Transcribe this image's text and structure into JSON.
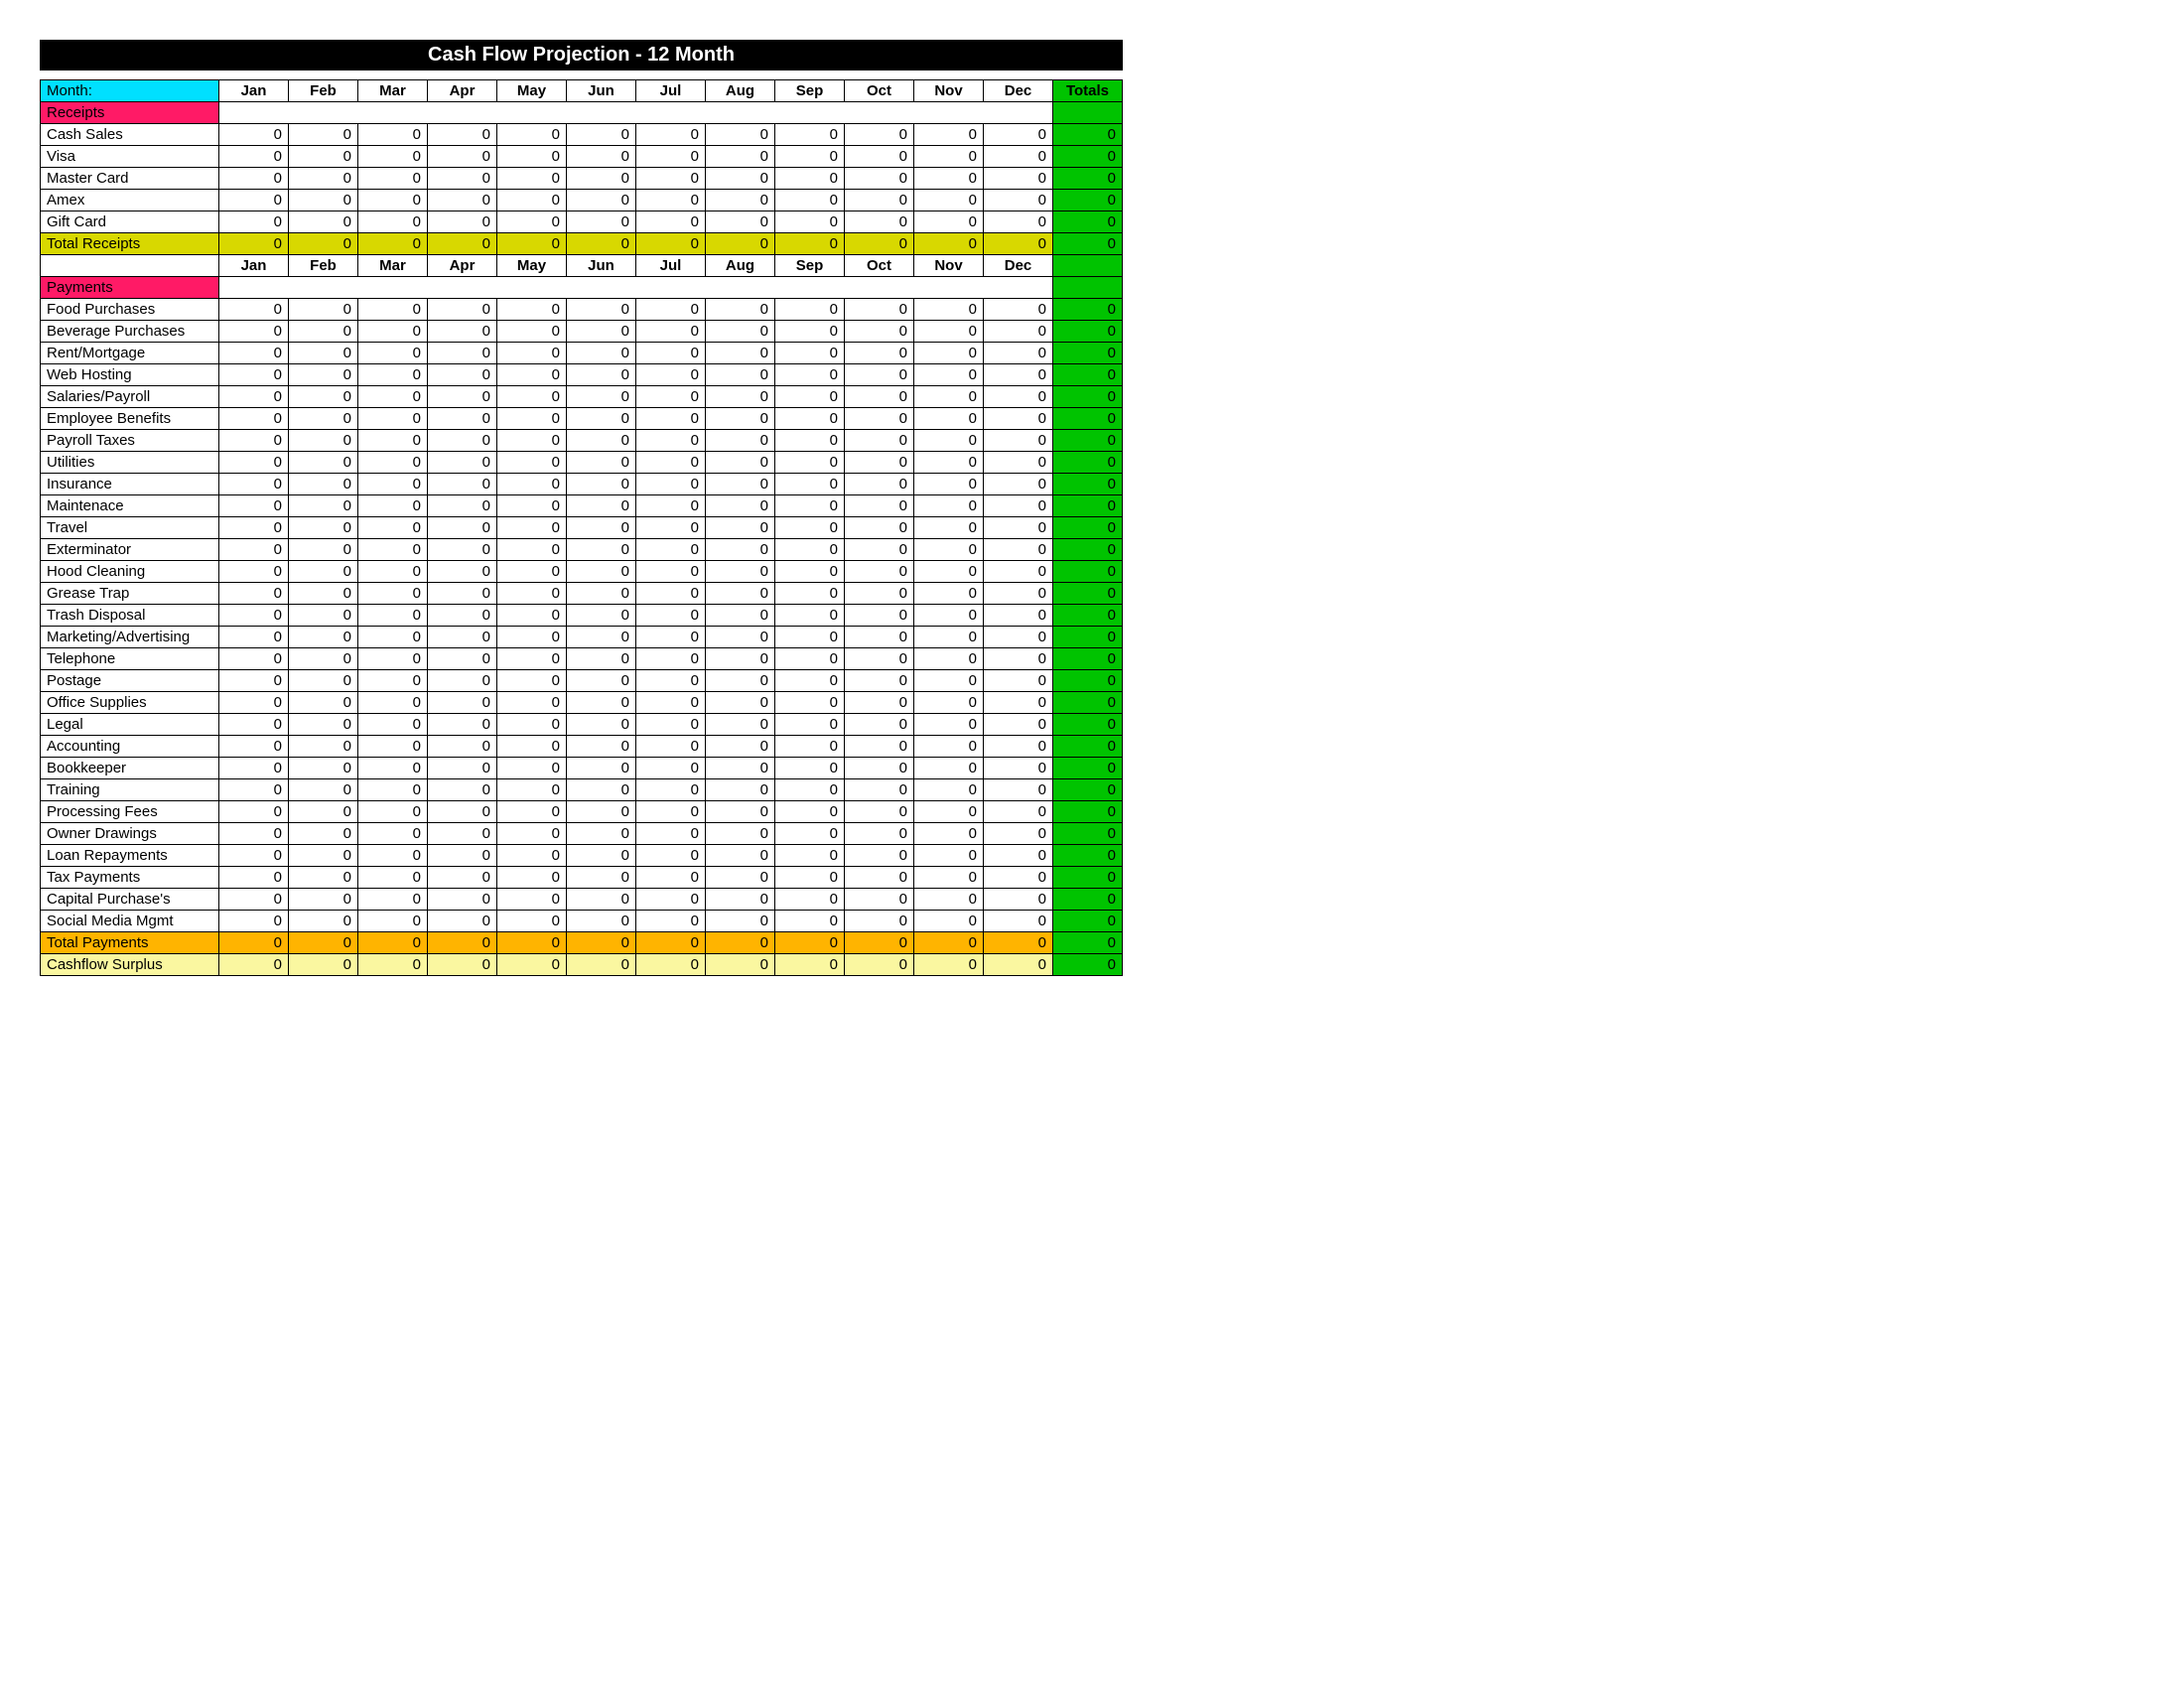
{
  "title": "Cash Flow Projection   -    12 Month",
  "month_label": "Month:",
  "months": [
    "Jan",
    "Feb",
    "Mar",
    "Apr",
    "May",
    "Jun",
    "Jul",
    "Aug",
    "Sep",
    "Oct",
    "Nov",
    "Dec"
  ],
  "totals_label": "Totals",
  "sections": {
    "receipts": {
      "heading": "Receipts",
      "rows": [
        {
          "label": "Cash Sales",
          "values": [
            0,
            0,
            0,
            0,
            0,
            0,
            0,
            0,
            0,
            0,
            0,
            0
          ],
          "total": 0
        },
        {
          "label": "Visa",
          "values": [
            0,
            0,
            0,
            0,
            0,
            0,
            0,
            0,
            0,
            0,
            0,
            0
          ],
          "total": 0
        },
        {
          "label": "Master Card",
          "values": [
            0,
            0,
            0,
            0,
            0,
            0,
            0,
            0,
            0,
            0,
            0,
            0
          ],
          "total": 0
        },
        {
          "label": "Amex",
          "values": [
            0,
            0,
            0,
            0,
            0,
            0,
            0,
            0,
            0,
            0,
            0,
            0
          ],
          "total": 0
        },
        {
          "label": "Gift Card",
          "values": [
            0,
            0,
            0,
            0,
            0,
            0,
            0,
            0,
            0,
            0,
            0,
            0
          ],
          "total": 0
        }
      ],
      "total_row": {
        "label": "Total Receipts",
        "values": [
          0,
          0,
          0,
          0,
          0,
          0,
          0,
          0,
          0,
          0,
          0,
          0
        ],
        "total": 0
      }
    },
    "payments": {
      "heading": "Payments",
      "rows": [
        {
          "label": "Food Purchases",
          "values": [
            0,
            0,
            0,
            0,
            0,
            0,
            0,
            0,
            0,
            0,
            0,
            0
          ],
          "total": 0
        },
        {
          "label": "Beverage Purchases",
          "values": [
            0,
            0,
            0,
            0,
            0,
            0,
            0,
            0,
            0,
            0,
            0,
            0
          ],
          "total": 0
        },
        {
          "label": "Rent/Mortgage",
          "values": [
            0,
            0,
            0,
            0,
            0,
            0,
            0,
            0,
            0,
            0,
            0,
            0
          ],
          "total": 0
        },
        {
          "label": "Web Hosting",
          "values": [
            0,
            0,
            0,
            0,
            0,
            0,
            0,
            0,
            0,
            0,
            0,
            0
          ],
          "total": 0
        },
        {
          "label": "Salaries/Payroll",
          "values": [
            0,
            0,
            0,
            0,
            0,
            0,
            0,
            0,
            0,
            0,
            0,
            0
          ],
          "total": 0
        },
        {
          "label": "Employee Benefits",
          "values": [
            0,
            0,
            0,
            0,
            0,
            0,
            0,
            0,
            0,
            0,
            0,
            0
          ],
          "total": 0
        },
        {
          "label": "Payroll Taxes",
          "values": [
            0,
            0,
            0,
            0,
            0,
            0,
            0,
            0,
            0,
            0,
            0,
            0
          ],
          "total": 0
        },
        {
          "label": "Utilities",
          "values": [
            0,
            0,
            0,
            0,
            0,
            0,
            0,
            0,
            0,
            0,
            0,
            0
          ],
          "total": 0
        },
        {
          "label": "Insurance",
          "values": [
            0,
            0,
            0,
            0,
            0,
            0,
            0,
            0,
            0,
            0,
            0,
            0
          ],
          "total": 0
        },
        {
          "label": "Maintenace",
          "values": [
            0,
            0,
            0,
            0,
            0,
            0,
            0,
            0,
            0,
            0,
            0,
            0
          ],
          "total": 0
        },
        {
          "label": "Travel",
          "values": [
            0,
            0,
            0,
            0,
            0,
            0,
            0,
            0,
            0,
            0,
            0,
            0
          ],
          "total": 0
        },
        {
          "label": "Exterminator",
          "values": [
            0,
            0,
            0,
            0,
            0,
            0,
            0,
            0,
            0,
            0,
            0,
            0
          ],
          "total": 0
        },
        {
          "label": "Hood Cleaning",
          "values": [
            0,
            0,
            0,
            0,
            0,
            0,
            0,
            0,
            0,
            0,
            0,
            0
          ],
          "total": 0
        },
        {
          "label": "Grease Trap",
          "values": [
            0,
            0,
            0,
            0,
            0,
            0,
            0,
            0,
            0,
            0,
            0,
            0
          ],
          "total": 0
        },
        {
          "label": "Trash Disposal",
          "values": [
            0,
            0,
            0,
            0,
            0,
            0,
            0,
            0,
            0,
            0,
            0,
            0
          ],
          "total": 0
        },
        {
          "label": "Marketing/Advertising",
          "values": [
            0,
            0,
            0,
            0,
            0,
            0,
            0,
            0,
            0,
            0,
            0,
            0
          ],
          "total": 0
        },
        {
          "label": "Telephone",
          "values": [
            0,
            0,
            0,
            0,
            0,
            0,
            0,
            0,
            0,
            0,
            0,
            0
          ],
          "total": 0
        },
        {
          "label": "Postage",
          "values": [
            0,
            0,
            0,
            0,
            0,
            0,
            0,
            0,
            0,
            0,
            0,
            0
          ],
          "total": 0
        },
        {
          "label": "Office Supplies",
          "values": [
            0,
            0,
            0,
            0,
            0,
            0,
            0,
            0,
            0,
            0,
            0,
            0
          ],
          "total": 0
        },
        {
          "label": "Legal",
          "values": [
            0,
            0,
            0,
            0,
            0,
            0,
            0,
            0,
            0,
            0,
            0,
            0
          ],
          "total": 0
        },
        {
          "label": "Accounting",
          "values": [
            0,
            0,
            0,
            0,
            0,
            0,
            0,
            0,
            0,
            0,
            0,
            0
          ],
          "total": 0
        },
        {
          "label": "Bookkeeper",
          "values": [
            0,
            0,
            0,
            0,
            0,
            0,
            0,
            0,
            0,
            0,
            0,
            0
          ],
          "total": 0
        },
        {
          "label": "Training",
          "values": [
            0,
            0,
            0,
            0,
            0,
            0,
            0,
            0,
            0,
            0,
            0,
            0
          ],
          "total": 0
        },
        {
          "label": "Processing Fees",
          "values": [
            0,
            0,
            0,
            0,
            0,
            0,
            0,
            0,
            0,
            0,
            0,
            0
          ],
          "total": 0
        },
        {
          "label": "Owner Drawings",
          "values": [
            0,
            0,
            0,
            0,
            0,
            0,
            0,
            0,
            0,
            0,
            0,
            0
          ],
          "total": 0
        },
        {
          "label": "Loan Repayments",
          "values": [
            0,
            0,
            0,
            0,
            0,
            0,
            0,
            0,
            0,
            0,
            0,
            0
          ],
          "total": 0
        },
        {
          "label": "Tax Payments",
          "values": [
            0,
            0,
            0,
            0,
            0,
            0,
            0,
            0,
            0,
            0,
            0,
            0
          ],
          "total": 0
        },
        {
          "label": "Capital Purchase's",
          "values": [
            0,
            0,
            0,
            0,
            0,
            0,
            0,
            0,
            0,
            0,
            0,
            0
          ],
          "total": 0
        },
        {
          "label": "Social Media Mgmt",
          "values": [
            0,
            0,
            0,
            0,
            0,
            0,
            0,
            0,
            0,
            0,
            0,
            0
          ],
          "total": 0
        }
      ],
      "total_row": {
        "label": "Total Payments",
        "values": [
          0,
          0,
          0,
          0,
          0,
          0,
          0,
          0,
          0,
          0,
          0,
          0
        ],
        "total": 0
      }
    }
  },
  "surplus_row": {
    "label": "Cashflow Surplus",
    "values": [
      0,
      0,
      0,
      0,
      0,
      0,
      0,
      0,
      0,
      0,
      0,
      0
    ],
    "total": 0
  }
}
